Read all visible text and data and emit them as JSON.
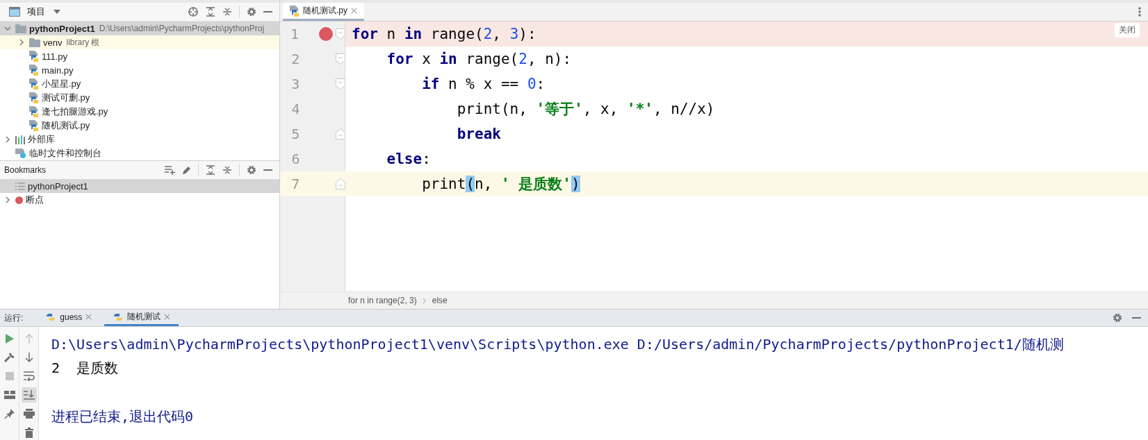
{
  "project_panel": {
    "title": "项目",
    "tree": [
      {
        "label": "pythonProject1",
        "hint": "D:\\Users\\admin\\PycharmProjects\\pythonProj",
        "kind": "project",
        "expanded": true,
        "selected": true,
        "highlighted": false,
        "children": [
          {
            "label": "venv",
            "hint": "library 根",
            "kind": "folder",
            "expanded": false,
            "selected": false,
            "highlighted": true
          },
          {
            "label": "111.py",
            "kind": "file",
            "selected": false,
            "highlighted": false
          },
          {
            "label": "main.py",
            "kind": "file",
            "selected": false,
            "highlighted": false
          },
          {
            "label": "小星星.py",
            "kind": "file",
            "selected": false,
            "highlighted": false
          },
          {
            "label": "测试可删.py",
            "kind": "file",
            "selected": false,
            "highlighted": false
          },
          {
            "label": "逢七拍腿游戏.py",
            "kind": "file",
            "selected": false,
            "highlighted": false
          },
          {
            "label": "随机测试.py",
            "kind": "file",
            "selected": false,
            "highlighted": false
          }
        ]
      },
      {
        "label": "外部库",
        "kind": "library",
        "expanded": false,
        "selected": false,
        "highlighted": false
      },
      {
        "label": "临时文件和控制台",
        "kind": "scratch",
        "selected": false,
        "highlighted": false
      }
    ]
  },
  "bookmarks_panel": {
    "title": "Bookmarks",
    "items": [
      {
        "label": "pythonProject1",
        "kind": "list",
        "selected": true
      },
      {
        "label": "断点",
        "kind": "breakpoints",
        "expanded": false,
        "selected": false
      }
    ]
  },
  "editor": {
    "tabs": [
      {
        "label": "随机测试.py",
        "selected": true
      }
    ],
    "close_hint": "关闭",
    "lines": [
      {
        "number": "1",
        "breakpoint": true,
        "current": false,
        "fold_open": true,
        "fold_close": false,
        "tokens": [
          {
            "kind": "keyword",
            "text": "for"
          },
          {
            "kind": "text",
            "text": " n "
          },
          {
            "kind": "keyword",
            "text": "in"
          },
          {
            "kind": "text",
            "text": " range("
          },
          {
            "kind": "number",
            "text": "2"
          },
          {
            "kind": "text",
            "text": ", "
          },
          {
            "kind": "number",
            "text": "3"
          },
          {
            "kind": "text",
            "text": "):"
          }
        ]
      },
      {
        "number": "2",
        "breakpoint": false,
        "current": false,
        "fold_open": true,
        "fold_close": false,
        "tokens": [
          {
            "kind": "keyword",
            "text": "    for"
          },
          {
            "kind": "text",
            "text": " x "
          },
          {
            "kind": "keyword",
            "text": "in"
          },
          {
            "kind": "text",
            "text": " range("
          },
          {
            "kind": "number",
            "text": "2"
          },
          {
            "kind": "text",
            "text": ", n):"
          }
        ]
      },
      {
        "number": "3",
        "breakpoint": false,
        "current": false,
        "fold_open": true,
        "fold_close": false,
        "tokens": [
          {
            "kind": "keyword",
            "text": "        if"
          },
          {
            "kind": "text",
            "text": " n % x == "
          },
          {
            "kind": "number",
            "text": "0"
          },
          {
            "kind": "text",
            "text": ":"
          }
        ]
      },
      {
        "number": "4",
        "breakpoint": false,
        "current": false,
        "fold_open": false,
        "fold_close": false,
        "tokens": [
          {
            "kind": "text",
            "text": "            print(n, "
          },
          {
            "kind": "string",
            "text": "'等于'"
          },
          {
            "kind": "text",
            "text": ", x, "
          },
          {
            "kind": "string",
            "text": "'*'"
          },
          {
            "kind": "text",
            "text": ", n//x)"
          }
        ]
      },
      {
        "number": "5",
        "breakpoint": false,
        "current": false,
        "fold_open": false,
        "fold_close": true,
        "tokens": [
          {
            "kind": "keyword",
            "text": "            break"
          }
        ]
      },
      {
        "number": "6",
        "breakpoint": false,
        "current": false,
        "fold_open": false,
        "fold_close": false,
        "tokens": [
          {
            "kind": "keyword",
            "text": "    else"
          },
          {
            "kind": "text",
            "text": ":"
          }
        ]
      },
      {
        "number": "7",
        "breakpoint": false,
        "current": true,
        "fold_open": false,
        "fold_close": true,
        "tokens": [
          {
            "kind": "text",
            "text": "        print"
          },
          {
            "kind": "match",
            "text": "("
          },
          {
            "kind": "text",
            "text": "n, "
          },
          {
            "kind": "string",
            "text": "' 是质数'"
          },
          {
            "kind": "match",
            "text": ")"
          }
        ]
      }
    ],
    "breadcrumbs": [
      "for n in range(2, 3)",
      "else"
    ]
  },
  "run_panel": {
    "label": "运行:",
    "tabs": [
      {
        "label": "guess",
        "selected": false
      },
      {
        "label": "随机测试",
        "selected": true
      }
    ],
    "tools_left": [
      {
        "kind": "run",
        "disabled": false
      },
      {
        "kind": "wrench",
        "disabled": false
      },
      {
        "kind": "stop",
        "disabled": true
      },
      {
        "kind": "layout",
        "disabled": false
      },
      {
        "kind": "pin",
        "disabled": false
      }
    ],
    "tools_right": [
      {
        "kind": "up",
        "disabled": true,
        "on": false
      },
      {
        "kind": "down",
        "disabled": false,
        "on": false
      },
      {
        "kind": "wrap",
        "disabled": false,
        "on": false
      },
      {
        "kind": "scroll-end",
        "disabled": false,
        "on": true
      },
      {
        "kind": "print",
        "disabled": false,
        "on": false
      },
      {
        "kind": "trash",
        "disabled": false,
        "on": false
      }
    ],
    "console": [
      {
        "kind": "command",
        "text": "D:\\Users\\admin\\PycharmProjects\\pythonProject1\\venv\\Scripts\\python.exe D:/Users/admin/PycharmProjects/pythonProject1/随机测"
      },
      {
        "kind": "output",
        "text": "2  是质数"
      },
      {
        "kind": "status",
        "text": "进程已结束,退出代码0"
      }
    ]
  }
}
